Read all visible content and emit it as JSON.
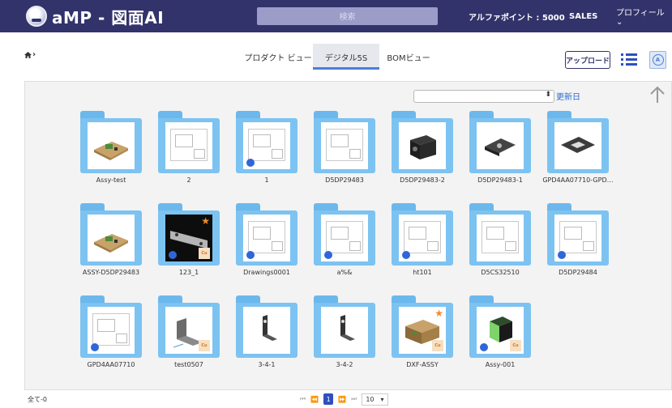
{
  "header": {
    "app_name": "aMP - 図面AI",
    "search_placeholder": "検索",
    "points": "アルファポイント : 5000",
    "user_role": "SALES",
    "profile": "プロフィール ⌄",
    "bg_color": "#32336a"
  },
  "breadcrumb": {
    "home_icon": "home-icon",
    "separator": "›"
  },
  "tabs": [
    {
      "label": "プロダクト ビュー",
      "active": false
    },
    {
      "label": "デジタル5S",
      "active": true
    },
    {
      "label": "BOMビュー",
      "active": false
    }
  ],
  "toolbar": {
    "upload_label": "アップロード",
    "list_view_icon": "list-icon",
    "avatar_icon": "avatar-icon",
    "avatar_letter": "A",
    "sort_value": "",
    "sort_link": "更新日",
    "accent_color": "#2f4fbf"
  },
  "folders": [
    {
      "name": "Assy-test",
      "thumb": "board"
    },
    {
      "name": "2",
      "thumb": "drawing"
    },
    {
      "name": "1",
      "thumb": "drawing",
      "dot": true
    },
    {
      "name": "D5DP29483",
      "thumb": "drawing"
    },
    {
      "name": "D5DP29483-2",
      "thumb": "block"
    },
    {
      "name": "D5DP29483-1",
      "thumb": "bracket"
    },
    {
      "name": "GPD4AA07710-GPD…",
      "thumb": "plate"
    },
    {
      "name": "ASSY-D5DP29483",
      "thumb": "board"
    },
    {
      "name": "123_1",
      "thumb": "dark",
      "dot": true,
      "star": true,
      "clip": true
    },
    {
      "name": "Drawings0001",
      "thumb": "drawing",
      "dot": true
    },
    {
      "name": "a%&",
      "thumb": "drawing",
      "dot": true
    },
    {
      "name": "ht101",
      "thumb": "drawing",
      "dot": true
    },
    {
      "name": "D5CS32510",
      "thumb": "drawing"
    },
    {
      "name": "D5DP29484",
      "thumb": "drawing",
      "dot": true
    },
    {
      "name": "GPD4AA07710",
      "thumb": "drawing",
      "dot": true
    },
    {
      "name": "test0507",
      "thumb": "angle",
      "clip": true
    },
    {
      "name": "3-4-1",
      "thumb": "lbracket"
    },
    {
      "name": "3-4-2",
      "thumb": "lbracket"
    },
    {
      "name": "DXF-ASSY",
      "thumb": "box",
      "star": true,
      "clip": true
    },
    {
      "name": "Assy-001",
      "thumb": "cube",
      "dot": true,
      "clip": true
    }
  ],
  "footer": {
    "total": "全て-0",
    "page_first": "⏮",
    "page_prev": "⏪",
    "current_page": "1",
    "page_next": "⏩",
    "page_last": "⏭",
    "page_size": "10",
    "page_size_caret": "▾"
  }
}
